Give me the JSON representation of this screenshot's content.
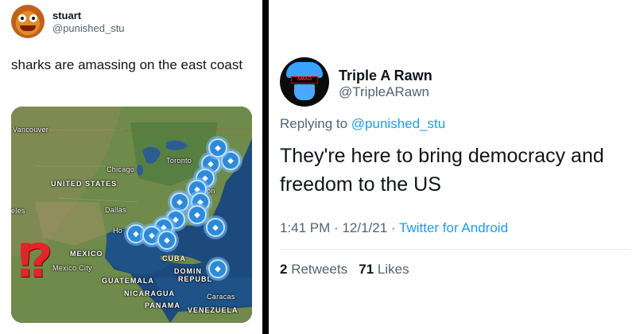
{
  "left_tweet": {
    "display_name": "stuart",
    "handle": "@punished_stu",
    "text": "sharks are amassing on the east coast",
    "map": {
      "labels": {
        "vancouver": "Vancouver",
        "chicago": "Chicago",
        "toronto": "Toronto",
        "united_states": "UNITED STATES",
        "angeles": "eles",
        "dallas": "Dallas",
        "houston": "Ho",
        "mexico": "MEXICO",
        "mexico_city": "Mexico City",
        "cuba": "CUBA",
        "dominican": "DOMIN",
        "republic": "REPUBL",
        "guatemala": "GUATEMALA",
        "nicaragua": "NICARAGUA",
        "panama": "PANAMA",
        "caracas": "Caracas",
        "venezuela": "VENEZUELA",
        "on": "on"
      },
      "overlay_glyph": "!?",
      "marker_icon": "shark-icon",
      "marker_color": "#2e8ad8"
    }
  },
  "right_tweet": {
    "display_name": "Triple A Rawn",
    "handle": "@TripleARawn",
    "avatar_band_text": "SMAO",
    "replying_prefix": "Replying to",
    "replying_to": "@punished_stu",
    "text": "They're here to bring democracy and freedom to the US",
    "time": "1:41 PM",
    "date": "12/1/21",
    "dot": "·",
    "client": "Twitter for Android",
    "retweets_count": "2",
    "retweets_label": "Retweets",
    "likes_count": "71",
    "likes_label": "Likes"
  },
  "colors": {
    "link": "#1d9bf0",
    "secondary_text": "#536471",
    "divider": "#000000"
  }
}
